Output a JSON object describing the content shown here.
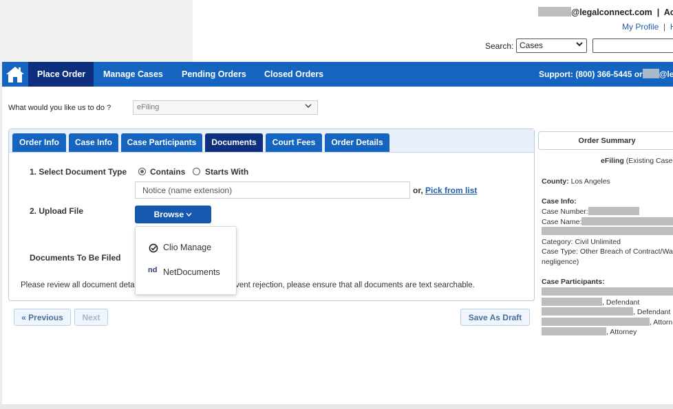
{
  "header": {
    "account_email_suffix": "@legalconnect.com",
    "account_separator": "|",
    "account_trail": "Acc",
    "my_profile": "My Profile",
    "profile_separator": "|",
    "profile_trail": "H",
    "search_label": "Search:",
    "search_selected": "Cases",
    "search_value": ""
  },
  "nav": {
    "items": [
      "Place Order",
      "Manage Cases",
      "Pending Orders",
      "Closed Orders"
    ],
    "support_prefix": "Support: (800) 366-5445 or",
    "support_suffix": "@leg"
  },
  "todo": {
    "label": "What would you like us to do ?",
    "selected": "eFiling"
  },
  "tabs": [
    "Order Info",
    "Case Info",
    "Case Participants",
    "Documents",
    "Court Fees",
    "Order Details"
  ],
  "documents": {
    "select_type_label": "1. Select Document Type",
    "contains": "Contains",
    "starts_with": "Starts With",
    "doc_input_value": "Notice (name extension)",
    "or_text": "or,",
    "pick_from_list": "Pick from list",
    "upload_label": "2. Upload File",
    "browse_label": "Browse",
    "to_be_filed_label": "Documents To Be Filed",
    "review_text_start": "Please review all document detai",
    "review_text_end": "vent rejection, please ensure that all documents are text searchable."
  },
  "dropdown": {
    "items": [
      "Clio Manage",
      "NetDocuments"
    ],
    "nd_logo": "nd"
  },
  "buttons": {
    "previous": "« Previous",
    "next": "Next",
    "save_draft": "Save As Draft"
  },
  "summary": {
    "title": "Order Summary",
    "efiling": "eFiling",
    "existing_case": "(Existing Case)",
    "county_label": "County:",
    "county_value": "Los Angeles",
    "case_info_title": "Case Info:",
    "case_number_label": "Case Number:",
    "case_name_label": "Case Name:",
    "category": "Category: Civil Unlimited",
    "case_type_line1": "Case Type: Other Breach of Contract/Warr",
    "case_type_line2": "negligence)",
    "participants_title": "Case Participants:",
    "participant_roles": [
      ", Defendant",
      ", Defendant",
      ", Attorn",
      ", Attorney"
    ]
  },
  "colors": {
    "nav_blue": "#1565c0",
    "nav_dark": "#0d2f7d",
    "link_blue": "#1f5fa9"
  }
}
